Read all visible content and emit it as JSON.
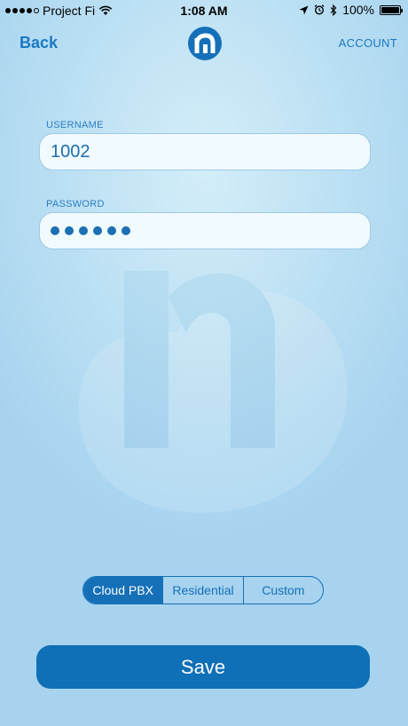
{
  "status_bar": {
    "carrier": "Project Fi",
    "time": "1:08 AM",
    "battery": "100%",
    "signal_icon": "signal-dots-icon",
    "wifi_icon": "wifi-icon",
    "location_icon": "location-arrow-icon",
    "alarm_icon": "alarm-icon",
    "bluetooth_icon": "bluetooth-icon",
    "battery_icon": "battery-icon"
  },
  "nav": {
    "back_label": "Back",
    "account_label": "ACCOUNT",
    "logo_icon": "brand-logo-icon"
  },
  "form": {
    "username_label": "USERNAME",
    "username_value": "1002",
    "password_label": "PASSWORD",
    "password_mask_length": 6
  },
  "segmented": {
    "options": [
      "Cloud PBX",
      "Residential",
      "Custom"
    ],
    "selected": "Cloud PBX"
  },
  "save_label": "Save",
  "colors": {
    "accent": "#1570b8",
    "field_bg": "#f1fafe",
    "background_light": "#d4eef9",
    "background_dark": "#a7d3ef"
  }
}
